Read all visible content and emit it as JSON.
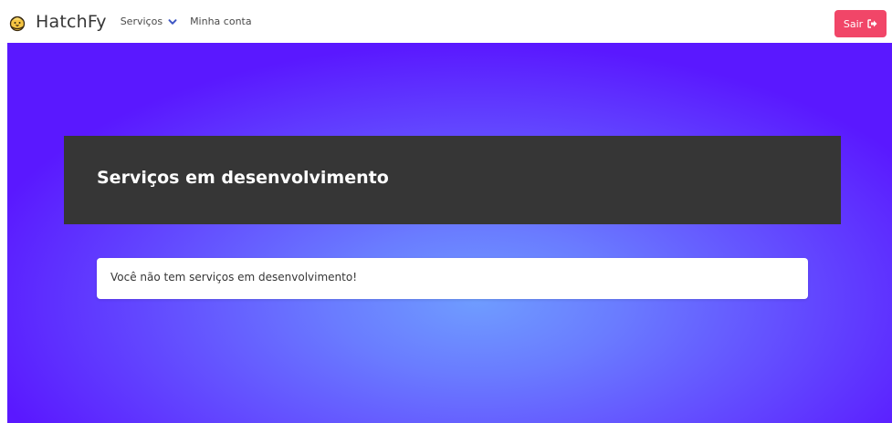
{
  "navbar": {
    "brand": "HatchFy",
    "brand_icon": "chick-icon",
    "menu": {
      "servicos_label": "Serviços",
      "minha_conta_label": "Minha conta"
    },
    "logout": {
      "label": "Sair",
      "icon": "sign-out-icon",
      "color": "#f14668"
    }
  },
  "main": {
    "banner_title": "Serviços em desenvolvimento",
    "empty_message": "Você não tem serviços em desenvolvimento!"
  },
  "colors": {
    "accent_chevron": "#3e56c4",
    "banner_bg": "#363636",
    "hero_gradient_center": "#6f9cff",
    "hero_gradient_edge": "#5a18ff"
  }
}
